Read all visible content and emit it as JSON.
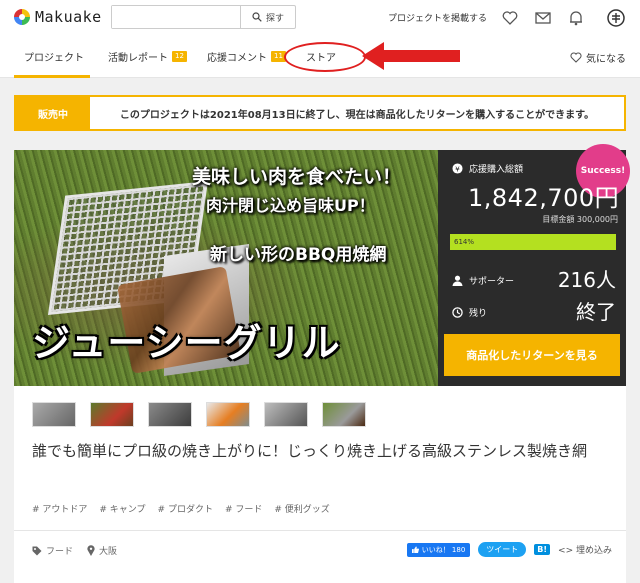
{
  "header": {
    "logo_text": "Makuake",
    "search_placeholder": "",
    "search_button": "探す",
    "post_link": "プロジェクトを掲載する"
  },
  "tabs": [
    {
      "label": "プロジェクト",
      "active": true
    },
    {
      "label": "活動レポート",
      "badge": "12"
    },
    {
      "label": "応援コメント",
      "badge": "11"
    },
    {
      "label": "ストア"
    }
  ],
  "favorite_label": "気になる",
  "notice": {
    "label": "販売中",
    "text": "このプロジェクトは2021年08月13日に終了し、現在は商品化したリターンを購入することができます。"
  },
  "hero": {
    "line1": "美味しい肉を食べたい！",
    "line2": "肉汁閉じ込め旨味UP！",
    "line3": "新しい形のBBQ用焼網",
    "big": "ジューシーグリル"
  },
  "stats": {
    "success_badge": "Success!",
    "amount_label": "応援購入総額",
    "amount": "1,842,700円",
    "goal": "目標金額 300,000円",
    "progress_text": "614%",
    "progress_fraction": 1.0,
    "supporters_label": "サポーター",
    "supporters": "216人",
    "remaining_label": "残り",
    "remaining": "終了",
    "cta": "商品化したリターンを見る"
  },
  "title": "誰でも簡単にプロ級の焼き上がりに！じっくり焼き上げる高級ステンレス製焼き網",
  "tags": [
    "# アウトドア",
    "# キャンプ",
    "# プロダクト",
    "# フード",
    "# 便利グッズ"
  ],
  "meta": {
    "category": "フード",
    "location": "大阪"
  },
  "share": {
    "fb": "いいね！ 180",
    "tweet": "ツイート",
    "hatena": "B!",
    "embed": "<> 埋め込み"
  },
  "colors": {
    "accent": "#f5b400",
    "success": "#e23d8a",
    "progress": "#b4e020",
    "annotation": "#e02020"
  }
}
